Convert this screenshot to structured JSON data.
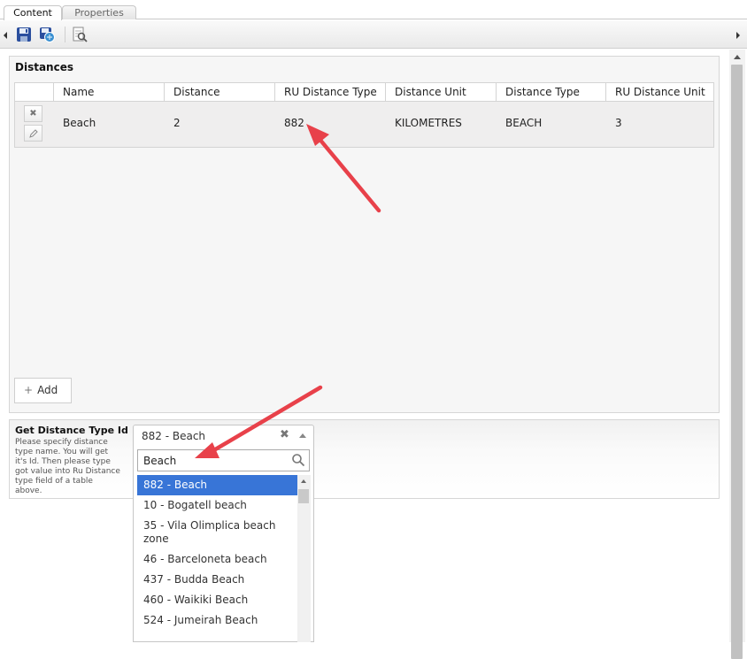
{
  "tabs": [
    {
      "label": "Content",
      "active": true
    },
    {
      "label": "Properties",
      "active": false
    }
  ],
  "toolbar": {
    "icons": [
      "save-icon",
      "save-and-publish-icon",
      "preview-icon"
    ]
  },
  "distances": {
    "title": "Distances",
    "columns": [
      "Name",
      "Distance",
      "RU Distance Type",
      "Distance Unit",
      "Distance Type",
      "RU Distance Unit"
    ],
    "rows": [
      {
        "name": "Beach",
        "distance": "2",
        "ru_distance_type": "882",
        "distance_unit": "KILOMETRES",
        "distance_type": "BEACH",
        "ru_distance_unit": "3"
      }
    ],
    "add_label": "Add"
  },
  "distance_type_lookup": {
    "title": "Get Distance Type Id",
    "description": "Please specify distance type name. You will get it's Id. Then please type got value into Ru Distance type field of a table above.",
    "selected": "882 - Beach",
    "search_value": "Beach",
    "options": [
      "882 - Beach",
      "10 - Bogatell beach",
      "35 - Vila Olimplica beach zone",
      "46 - Barceloneta beach",
      "437 - Budda Beach",
      "460 - Waikiki Beach",
      "524 - Jumeirah Beach"
    ],
    "highlighted_index": 0
  },
  "colors": {
    "selection": "#3875d7",
    "annotation_arrow": "#e8414a"
  }
}
